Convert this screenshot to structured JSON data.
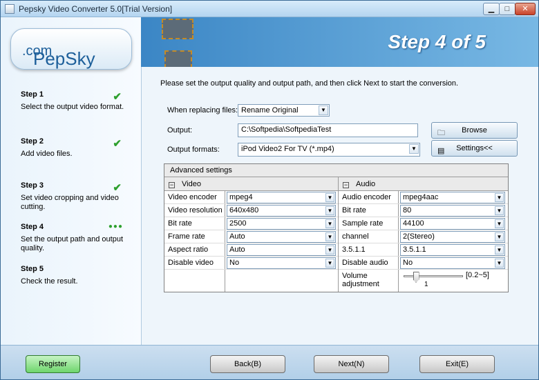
{
  "window": {
    "title": "Pepsky Video Converter 5.0[Trial Version]"
  },
  "logo": {
    "text": "PepSky",
    "suffix": ".com"
  },
  "banner": {
    "step_text": "Step 4 of 5"
  },
  "steps": [
    {
      "title": "Step 1",
      "desc": "Select the output video format.",
      "state": "done"
    },
    {
      "title": "Step 2",
      "desc": "Add video files.",
      "state": "done"
    },
    {
      "title": "Step 3",
      "desc": "Set video cropping and video cutting.",
      "state": "done"
    },
    {
      "title": "Step 4",
      "desc": "Set the output path and output quality.",
      "state": "current"
    },
    {
      "title": "Step 5",
      "desc": "Check the result.",
      "state": "pending"
    }
  ],
  "instructions": "Please set the output quality and output path, and then click Next to start the conversion.",
  "form": {
    "replace_label": "When replacing files:",
    "replace_value": "Rename Original",
    "output_label": "Output:",
    "output_value": "C:\\Softpedia\\SoftpediaTest",
    "formats_label": "Output formats:",
    "formats_value": "iPod Video2 For TV (*.mp4)",
    "browse_label": "Browse",
    "settings_label": "Settings<<"
  },
  "advanced": {
    "title": "Advanced settings",
    "video": {
      "header": "Video",
      "rows": [
        {
          "key": "Video encoder",
          "value": "mpeg4"
        },
        {
          "key": "Video resolution",
          "value": "640x480"
        },
        {
          "key": "Bit rate",
          "value": "2500"
        },
        {
          "key": "Frame rate",
          "value": "Auto"
        },
        {
          "key": "Aspect ratio",
          "value": "Auto"
        },
        {
          "key": "Disable video",
          "value": "No"
        }
      ]
    },
    "audio": {
      "header": "Audio",
      "rows": [
        {
          "key": "Audio encoder",
          "value": "mpeg4aac"
        },
        {
          "key": "Bit rate",
          "value": "80"
        },
        {
          "key": "Sample rate",
          "value": "44100"
        },
        {
          "key": "channel",
          "value": "2(Stereo)"
        },
        {
          "key": "3.5.1.1",
          "value": "3.5.1.1"
        },
        {
          "key": "Disable audio",
          "value": "No"
        }
      ],
      "volume_label": "Volume adjustment",
      "volume_value": "1",
      "volume_range": "[0.2~5]",
      "volume_level": 1
    }
  },
  "buttons": {
    "register": "Register",
    "back": "Back(B)",
    "next": "Next(N)",
    "exit": "Exit(E)"
  }
}
